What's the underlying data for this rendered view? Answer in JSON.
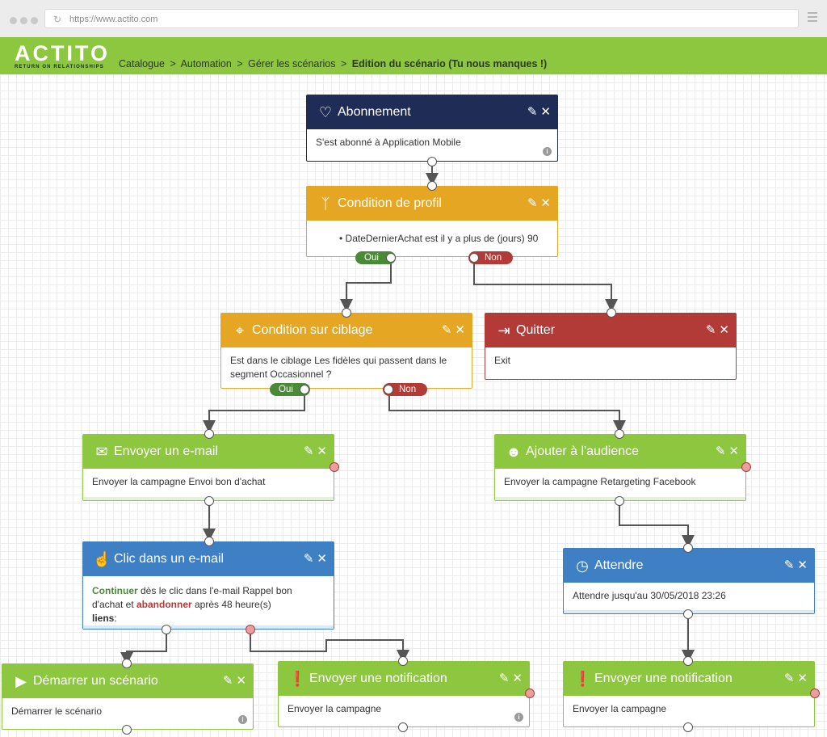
{
  "browser": {
    "url": "https://www.actito.com"
  },
  "app": {
    "logo_text": "ACTITO",
    "logo_tagline": "RETURN ON RELATIONSHIPS",
    "breadcrumb": [
      "Catalogue",
      "Automation",
      "Gérer les scénarios"
    ],
    "breadcrumb_separator": ">",
    "breadcrumb_current": "Edition du scénario (Tu nous manques !)"
  },
  "colors": {
    "navy": "#1f2d56",
    "gold": "#e5a624",
    "red": "#b23a37",
    "green": "#8dc63f",
    "blue": "#3f80c5"
  },
  "nodes": {
    "abonnement": {
      "title": "Abonnement",
      "icon": "heart-icon",
      "body": "S'est abonné à Application Mobile"
    },
    "cond_profil": {
      "title": "Condition de profil",
      "icon": "branch-icon",
      "body": "DateDernierAchat est il y a plus de (jours) 90",
      "yes": "Oui",
      "no": "Non"
    },
    "cond_ciblage": {
      "title": "Condition sur ciblage",
      "icon": "crosshair-icon",
      "body": "Est dans le ciblage Les fidèles qui passent dans le segment Occasionnel ?",
      "yes": "Oui",
      "no": "Non"
    },
    "quitter": {
      "title": "Quitter",
      "icon": "exit-icon",
      "body": "Exit"
    },
    "email": {
      "title": "Envoyer un e-mail",
      "icon": "envelope-icon",
      "body": "Envoyer la campagne Envoi bon d'achat"
    },
    "audience": {
      "title": "Ajouter à l'audience",
      "icon": "users-icon",
      "body": "Envoyer la campagne Retargeting Facebook"
    },
    "clic": {
      "title": "Clic dans un e-mail",
      "icon": "pointer-icon",
      "body_continue": "Continuer",
      "body_mid": " dès le clic dans l'e-mail Rappel bon d'achat et ",
      "body_abandon": "abandonner",
      "body_end": " après 48 heure(s)",
      "body_links": "liens",
      "body_colon": ":"
    },
    "attendre": {
      "title": "Attendre",
      "icon": "clock-icon",
      "body": "Attendre jusqu'au 30/05/2018 23:26"
    },
    "demarrer": {
      "title": "Démarrer un scénario",
      "icon": "play-icon",
      "body": "Démarrer le scénario"
    },
    "notif1": {
      "title": "Envoyer une notification",
      "icon": "alert-icon",
      "body": "Envoyer la campagne"
    },
    "notif2": {
      "title": "Envoyer une notification",
      "icon": "alert-icon",
      "body": "Envoyer la campagne"
    }
  }
}
